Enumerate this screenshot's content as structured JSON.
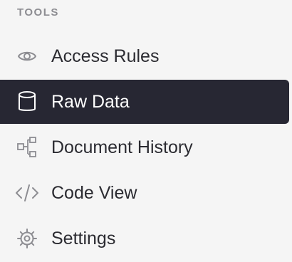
{
  "sidebar": {
    "section_title": "TOOLS",
    "items": [
      {
        "label": "Access Rules",
        "icon": "eye-icon",
        "active": false
      },
      {
        "label": "Raw Data",
        "icon": "database-icon",
        "active": true
      },
      {
        "label": "Document History",
        "icon": "document-history-icon",
        "active": false
      },
      {
        "label": "Code View",
        "icon": "code-icon",
        "active": false
      },
      {
        "label": "Settings",
        "icon": "gear-icon",
        "active": false
      }
    ]
  },
  "colors": {
    "background": "#f5f5f5",
    "active_background": "#272733",
    "active_text": "#ffffff",
    "text": "#2b2b31",
    "icon_inactive": "#8d8d92",
    "section_title": "#8d8d92"
  }
}
